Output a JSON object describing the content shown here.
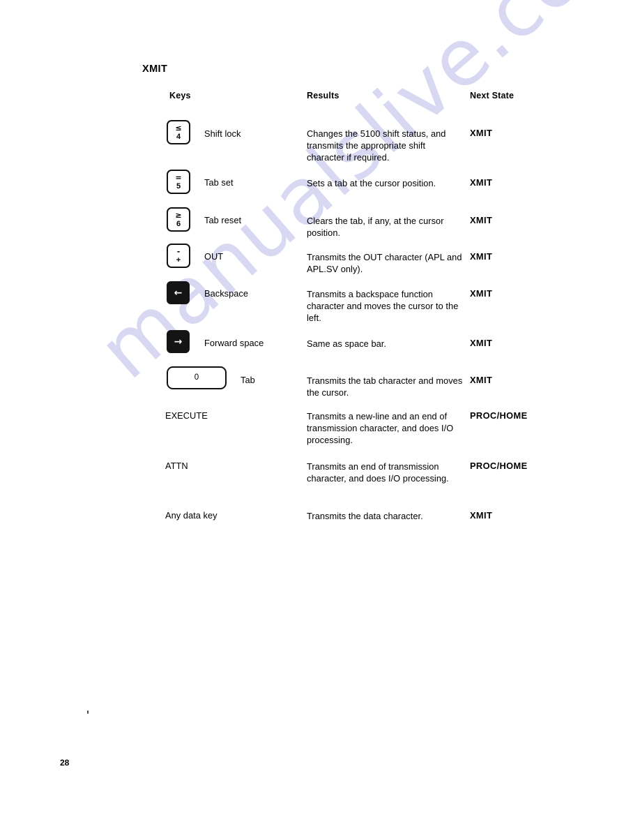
{
  "page": {
    "section_title": "XMIT",
    "folio": "28",
    "watermark_text": "manualslive.com"
  },
  "table": {
    "headers": {
      "keys": "Keys",
      "results": "Results",
      "next_state": "Next State"
    },
    "rows": [
      {
        "key_type": "keycap",
        "key_upper": "≤",
        "key_lower": "4",
        "key_label": "Shift lock",
        "results": "Changes the 5100 shift status, and transmits the appropriate shift character if required.",
        "next_state": "XMIT"
      },
      {
        "key_type": "keycap",
        "key_upper": "=",
        "key_lower": "5",
        "key_label": "Tab set",
        "results": "Sets a tab at the cursor position.",
        "next_state": "XMIT"
      },
      {
        "key_type": "keycap",
        "key_upper": "≥",
        "key_lower": "6",
        "key_label": "Tab reset",
        "results": "Clears the tab, if any, at the cursor position.",
        "next_state": "XMIT"
      },
      {
        "key_type": "keycap",
        "key_upper": "-",
        "key_lower": "+",
        "key_label": "OUT",
        "results": "Transmits the OUT character (APL and APL.SV only).",
        "next_state": "XMIT"
      },
      {
        "key_type": "dark",
        "key_glyph": "←",
        "key_label": "Backspace",
        "results": "Transmits a backspace function character and moves the cursor to the left.",
        "next_state": "XMIT"
      },
      {
        "key_type": "dark",
        "key_glyph": "→",
        "key_label": "Forward space",
        "results": "Same as space bar.",
        "next_state": "XMIT"
      },
      {
        "key_type": "wide",
        "key_upper": "0",
        "key_label": "Tab",
        "results": "Transmits the tab character and moves the cursor.",
        "next_state": "XMIT"
      },
      {
        "key_type": "text",
        "key_label": "EXECUTE",
        "results": "Transmits a new-line and an end of transmission character, and does I/O processing.",
        "next_state": "PROC/HOME"
      },
      {
        "key_type": "text",
        "key_label": "ATTN",
        "results": "Transmits an end of transmission character, and does I/O processing.",
        "next_state": "PROC/HOME"
      },
      {
        "key_type": "text",
        "key_label": "Any data key",
        "results": "Transmits the data character.",
        "next_state": "XMIT"
      }
    ]
  },
  "colors": {
    "ink": "#000000",
    "key_dark": "#141414",
    "watermark": "#d9d8f2",
    "paper": "#ffffff"
  }
}
